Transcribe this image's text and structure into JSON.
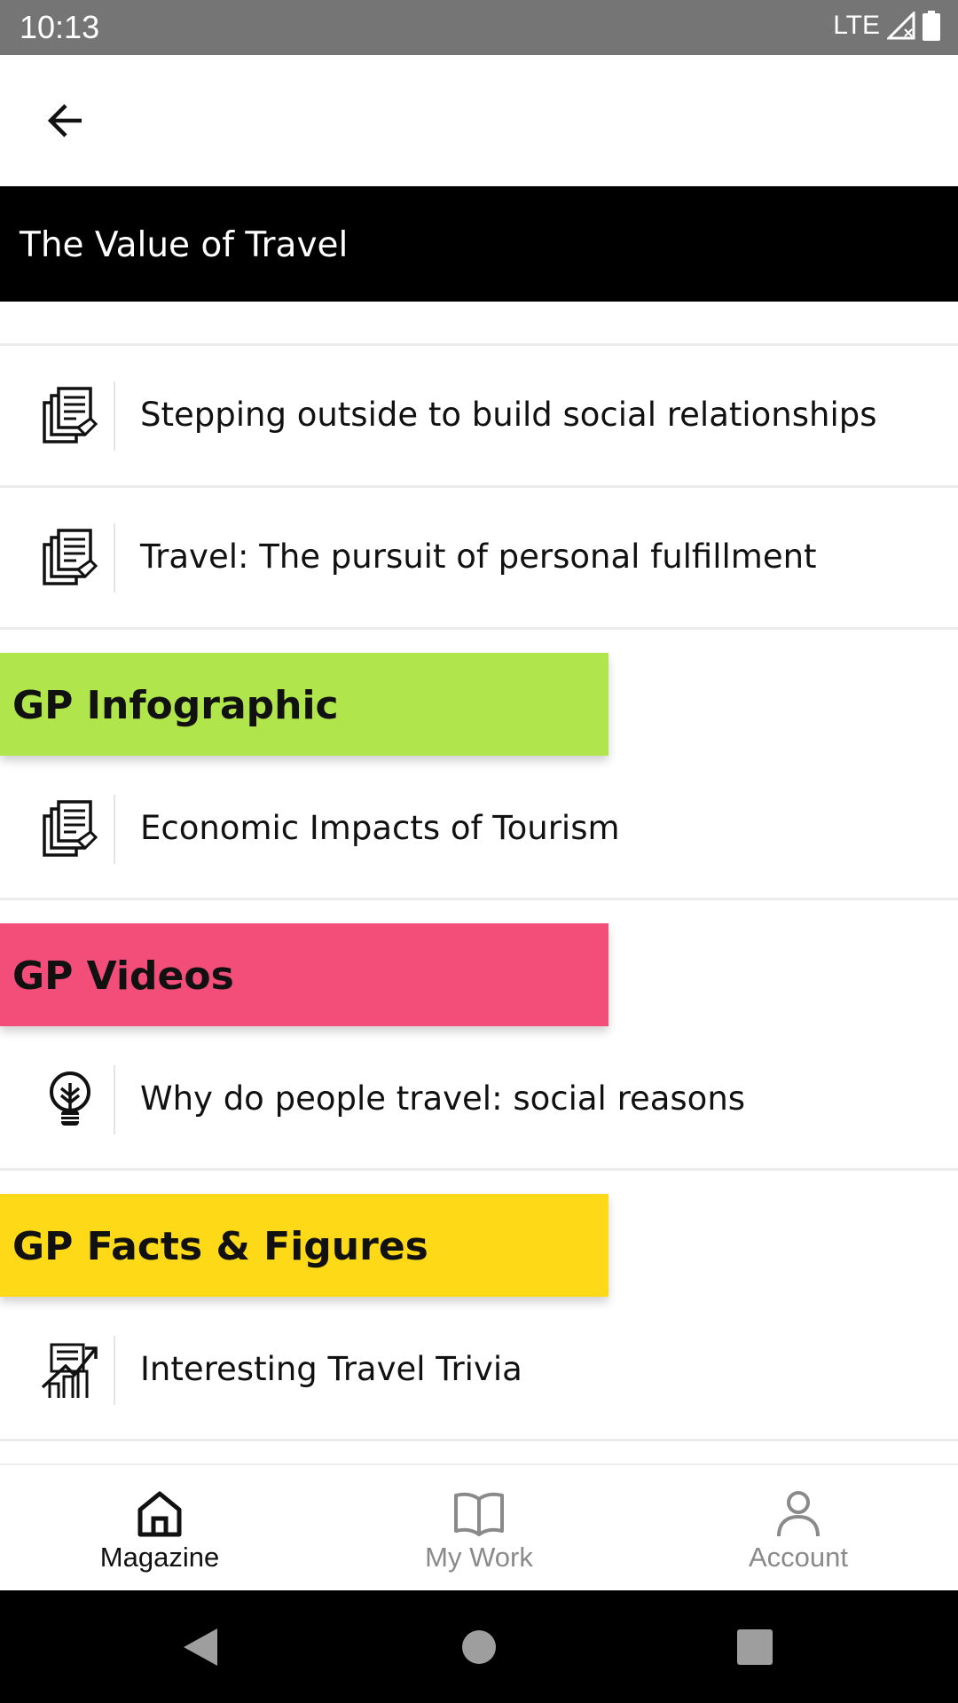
{
  "status_bar": {
    "time": "10:13",
    "network": "LTE"
  },
  "app_bar": {
    "back_icon": "arrow-left-icon"
  },
  "title": "The Value of Travel",
  "rows_top": [
    {
      "label": "Stepping outside to build social relationships",
      "icon": "document-stack-icon"
    },
    {
      "label": "Travel: The pursuit of personal fulfillment",
      "icon": "document-stack-icon"
    }
  ],
  "sections": [
    {
      "title": "GP Infographic",
      "color": "#b0e64b",
      "items": [
        {
          "label": "Economic Impacts of Tourism",
          "icon": "document-stack-icon"
        }
      ]
    },
    {
      "title": "GP Videos",
      "color": "#f34e7a",
      "items": [
        {
          "label": "Why do people travel: social reasons",
          "icon": "lightbulb-icon"
        }
      ]
    },
    {
      "title": "GP Facts & Figures",
      "color": "#fed918",
      "items": [
        {
          "label": "Interesting Travel Trivia",
          "icon": "chart-growth-icon"
        }
      ]
    }
  ],
  "bottom_nav": [
    {
      "label": "Magazine",
      "icon": "home-icon",
      "active": true
    },
    {
      "label": "My Work",
      "icon": "book-icon",
      "active": false
    },
    {
      "label": "Account",
      "icon": "person-icon",
      "active": false
    }
  ],
  "colors": {
    "active": "#111111",
    "inactive": "#8a8a8a"
  }
}
